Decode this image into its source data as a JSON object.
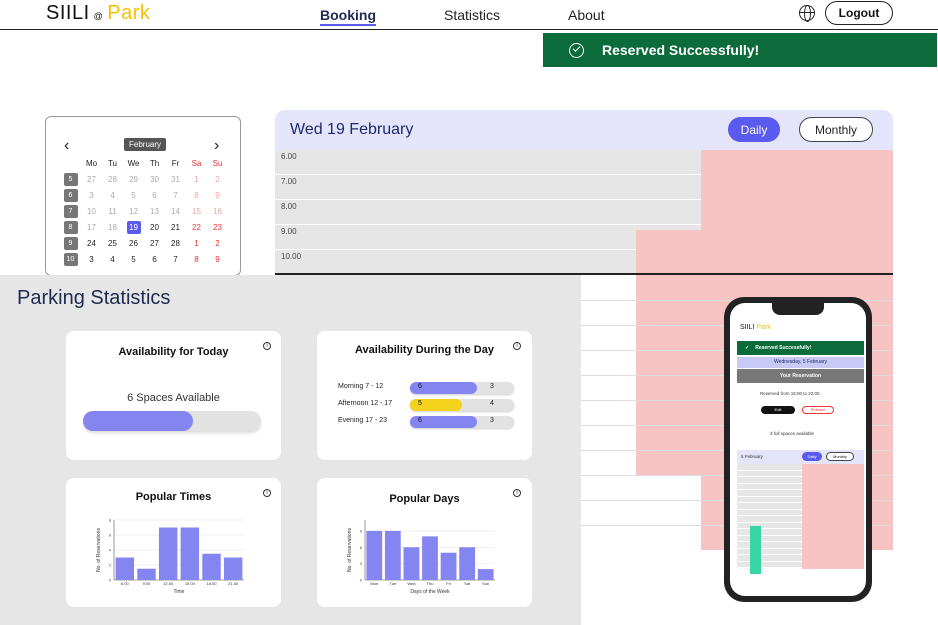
{
  "nav": {
    "logo_main": "SIILI",
    "logo_at": "@",
    "logo_park": "Park",
    "links": [
      "Booking",
      "Statistics",
      "About"
    ],
    "logout": "Logout"
  },
  "toast": {
    "message": "Reserved Successfully!"
  },
  "calendar": {
    "month": "February",
    "weekday_headers": [
      "Mo",
      "Tu",
      "We",
      "Th",
      "Fr",
      "Sa",
      "Su"
    ],
    "rows": [
      {
        "week": "5",
        "days": [
          "27",
          "28",
          "29",
          "30",
          "31",
          "1",
          "2"
        ]
      },
      {
        "week": "6",
        "days": [
          "3",
          "4",
          "5",
          "6",
          "7",
          "8",
          "9"
        ]
      },
      {
        "week": "7",
        "days": [
          "10",
          "11",
          "12",
          "13",
          "14",
          "15",
          "16"
        ]
      },
      {
        "week": "8",
        "days": [
          "17",
          "18",
          "19",
          "20",
          "21",
          "22",
          "23"
        ]
      },
      {
        "week": "9",
        "days": [
          "24",
          "25",
          "26",
          "27",
          "28",
          "1",
          "2"
        ]
      },
      {
        "week": "10",
        "days": [
          "3",
          "4",
          "5",
          "6",
          "7",
          "8",
          "9"
        ]
      }
    ],
    "selected": "19"
  },
  "schedule": {
    "date_title": "Wed 19 February",
    "daily": "Daily",
    "monthly": "Monthly",
    "times": [
      "6.00",
      "7.00",
      "8.00",
      "9.00",
      "10.00"
    ]
  },
  "stats": {
    "title": "Parking Statistics",
    "availability_today": {
      "title": "Availability for Today",
      "label": "6 Spaces Available",
      "fill_fraction": 0.62
    },
    "availability_day": {
      "title": "Availability During the Day",
      "rows": [
        {
          "label": "Morning 7 - 12",
          "available": "6",
          "other": "3",
          "fraction": 0.64,
          "color": "#8585f2"
        },
        {
          "label": "Afternoon 12 - 17",
          "available": "5",
          "other": "4",
          "fraction": 0.5,
          "color": "#f2d21b"
        },
        {
          "label": "Evening 17 - 23",
          "available": "6",
          "other": "3",
          "fraction": 0.64,
          "color": "#8585f2"
        }
      ]
    },
    "popular_times": {
      "title": "Popular Times",
      "ylabel": "No. of Reservations",
      "xlabel": "Time"
    },
    "popular_days": {
      "title": "Popular Days",
      "ylabel": "No. of Reservations",
      "xlabel": "Days of the Week"
    }
  },
  "chart_data": [
    {
      "type": "bar",
      "title": "Popular Times",
      "xlabel": "Time",
      "ylabel": "No. of Reservations",
      "categories": [
        "6.00",
        "9.00",
        "12.00",
        "15.00",
        "18.00",
        "21.00"
      ],
      "values": [
        3,
        1.5,
        7,
        7,
        3.5,
        3
      ],
      "ylim": [
        0,
        8
      ],
      "yticks": [
        "0",
        "2",
        "4",
        "6",
        "8"
      ]
    },
    {
      "type": "bar",
      "title": "Popular Days",
      "xlabel": "Days of the Week",
      "ylabel": "No. of Reservations",
      "categories": [
        "Mon",
        "Tue",
        "Wed",
        "Thu",
        "Fri",
        "Sat",
        "Sun"
      ],
      "values": [
        9,
        9,
        6,
        8,
        5,
        6,
        2
      ],
      "ylim": [
        0,
        11
      ],
      "yticks": [
        "0",
        "3",
        "6",
        "9"
      ]
    }
  ],
  "phone": {
    "logo_main": "SIILI",
    "logo_park": "Park",
    "toast": "Reserved Successfully!",
    "date": "Wednesday, 5 February",
    "your_reservation": "Your Reservation",
    "reserved_text": "Reserved from 15:00 to 22:00",
    "edit": "Edit",
    "release": "Release",
    "spaces": "3 full spaces available",
    "sched_date": "5 February",
    "daily": "Daily",
    "monthly": "Monthly"
  },
  "colors": {
    "accent": "#5a5aee",
    "toast_green": "#0b6b3a",
    "reserved_red": "#f8c3c3",
    "brand_yellow": "#f2c200"
  }
}
